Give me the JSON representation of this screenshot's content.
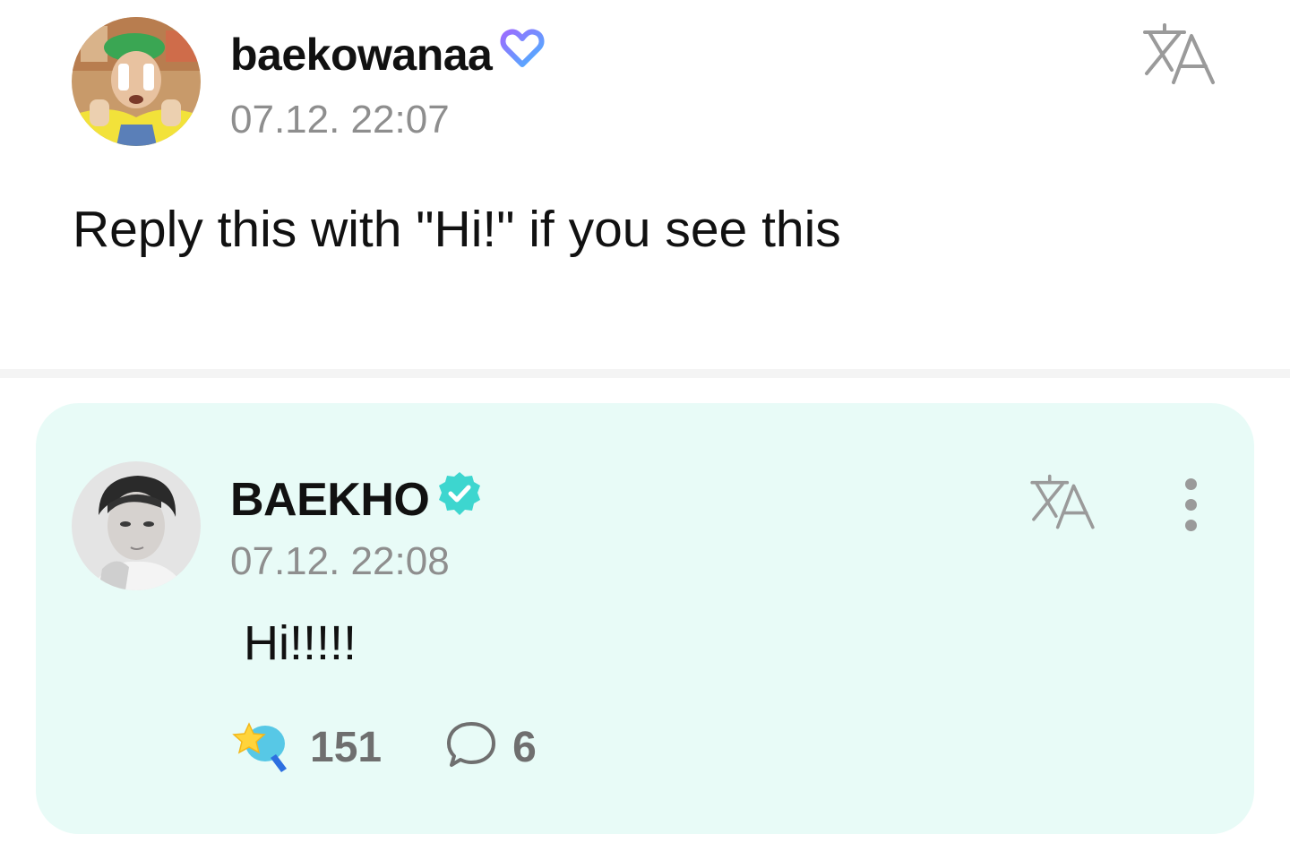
{
  "post": {
    "username": "baekowanaa",
    "timestamp": "07.12. 22:07",
    "text": "Reply this with \"Hi!\" if you see this",
    "badge_icon": "heart-membership-icon"
  },
  "reply": {
    "username": "BAEKHO",
    "timestamp": "07.12. 22:08",
    "text": "Hi!!!!!",
    "badge_icon": "verified-badge-icon",
    "likes": "151",
    "comments": "6"
  },
  "colors": {
    "reply_background": "#e8fbf7",
    "verified_badge": "#3dd6cf",
    "timestamp_gray": "#8e8e8e",
    "icon_gray": "#9a9a9a"
  }
}
